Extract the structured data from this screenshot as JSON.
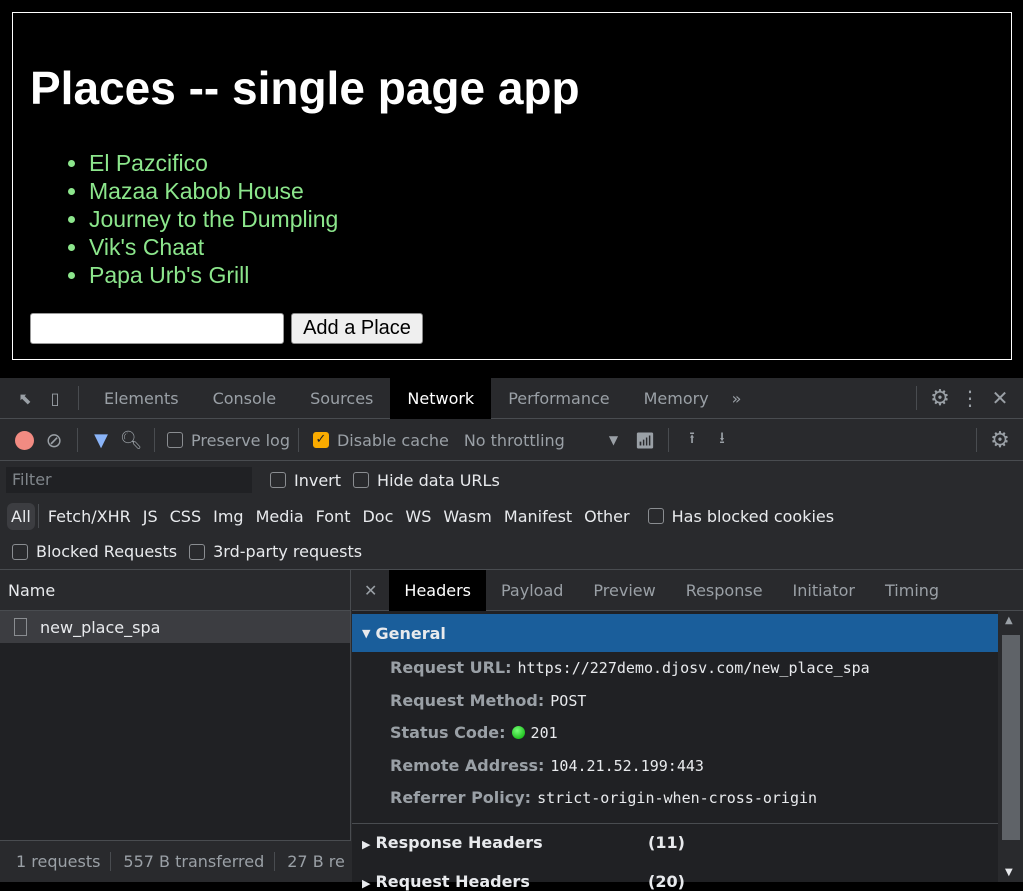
{
  "page": {
    "title": "Places -- single page app",
    "places": [
      "El Pazcifico",
      "Mazaa Kabob House",
      "Journey to the Dumpling",
      "Vik's Chaat",
      "Papa Urb's Grill"
    ],
    "input_value": "",
    "button": "Add a Place"
  },
  "devtools": {
    "tabs": [
      "Elements",
      "Console",
      "Sources",
      "Network",
      "Performance",
      "Memory"
    ],
    "more": "»",
    "toolbar": {
      "preserve_log": "Preserve log",
      "disable_cache": "Disable cache",
      "throttling": "No throttling"
    },
    "filter": {
      "placeholder": "Filter",
      "invert": "Invert",
      "hide_data_urls": "Hide data URLs"
    },
    "types": [
      "All",
      "Fetch/XHR",
      "JS",
      "CSS",
      "Img",
      "Media",
      "Font",
      "Doc",
      "WS",
      "Wasm",
      "Manifest",
      "Other"
    ],
    "has_blocked_cookies": "Has blocked cookies",
    "blocked_requests": "Blocked Requests",
    "third_party": "3rd-party requests",
    "name_header": "Name",
    "requests": [
      {
        "name": "new_place_spa"
      }
    ],
    "status": {
      "requests": "1 requests",
      "transferred": "557 B transferred",
      "resources": "27 B re"
    },
    "detail_tabs": [
      "Headers",
      "Payload",
      "Preview",
      "Response",
      "Initiator",
      "Timing"
    ],
    "general": {
      "title": "General",
      "fields": [
        {
          "key": "Request URL:",
          "value": "https://227demo.djosv.com/new_place_spa"
        },
        {
          "key": "Request Method:",
          "value": "POST"
        },
        {
          "key": "Status Code:",
          "value": "201"
        },
        {
          "key": "Remote Address:",
          "value": "104.21.52.199:443"
        },
        {
          "key": "Referrer Policy:",
          "value": "strict-origin-when-cross-origin"
        }
      ]
    },
    "sections": [
      {
        "title": "Response Headers",
        "count": "(11)"
      },
      {
        "title": "Request Headers",
        "count": "(20)"
      }
    ],
    "colors": {
      "status_ok": "#22c322",
      "accent": "#1a5e9b",
      "record": "#f28b82"
    }
  }
}
